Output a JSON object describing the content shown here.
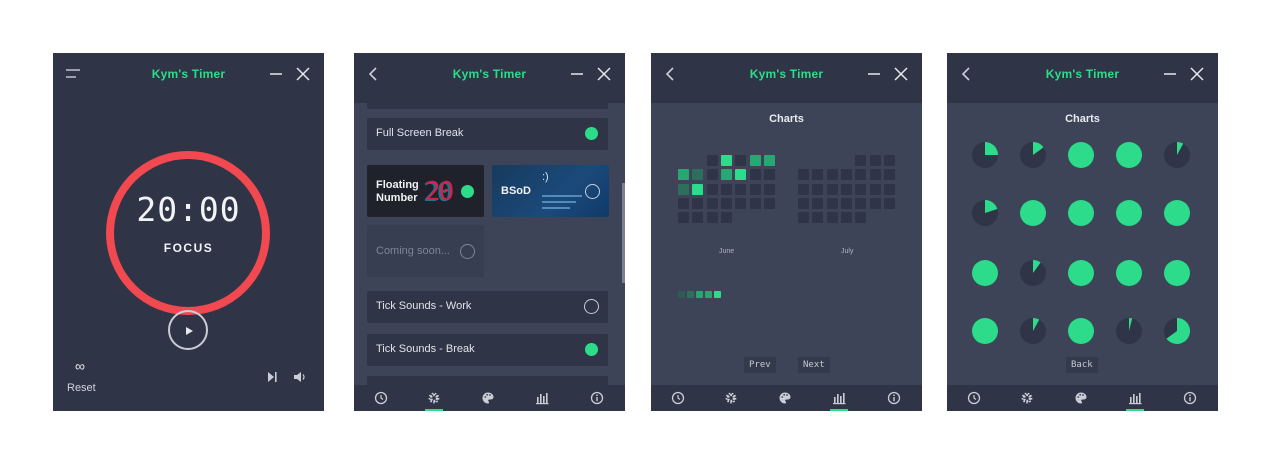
{
  "app": {
    "title": "Kym's Timer"
  },
  "accent": "#2ddc8a",
  "ring_color": "#f2484f",
  "timer": {
    "time": "20:00",
    "mode": "FOCUS",
    "rounds": "∞",
    "reset_label": "Reset"
  },
  "settings": {
    "items": [
      {
        "label": "Full Screen Break",
        "checked": true
      },
      {
        "label": "Tick Sounds - Work",
        "checked": false
      },
      {
        "label": "Tick Sounds - Break",
        "checked": true
      }
    ],
    "break_styles": [
      {
        "label": "Floating Number",
        "selected": true
      },
      {
        "label": "BSoD",
        "selected": false
      },
      {
        "label": "Coming soon...",
        "selected": false
      }
    ]
  },
  "charts": {
    "title": "Charts",
    "months": [
      "June",
      "July"
    ],
    "prev_label": "Prev",
    "next_label": "Next",
    "back_label": "Back"
  },
  "nav": [
    "clock-icon",
    "gear-icon",
    "palette-icon",
    "bar-chart-icon",
    "info-icon"
  ],
  "pie_fractions": [
    0.25,
    0.15,
    1,
    1,
    0.08,
    0.2,
    1,
    1,
    1,
    1,
    1,
    0.1,
    1,
    1,
    1,
    1,
    0.08,
    1,
    0.04,
    0.65
  ]
}
